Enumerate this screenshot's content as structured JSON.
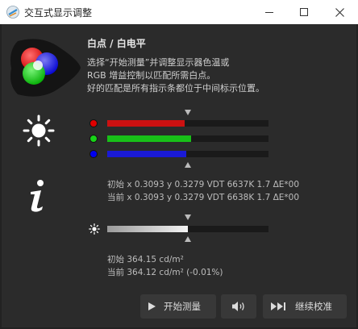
{
  "window": {
    "title": "交互式显示调整"
  },
  "header": {
    "heading": "白点 / 白电平",
    "desc_line1": "选择“开始测量”并调整显示器色温或",
    "desc_line2": "RGB 增益控制以匹配所需白点。",
    "desc_line3": "好的匹配是所有指示条都位于中间标示位置。"
  },
  "rgb_bars": {
    "red": {
      "level": 0.48,
      "color": "#cc1111"
    },
    "green": {
      "level": 0.52,
      "color": "#18c018"
    },
    "blue": {
      "level": 0.49,
      "color": "#1a1ad6"
    }
  },
  "white_point": {
    "initial": "初始 x 0.3093 y 0.3279 VDT 6637K 1.7 ΔE*00",
    "current": "当前 x 0.3093 y 0.3279 VDT 6638K 1.7 ΔE*00"
  },
  "luminance": {
    "level": 0.5,
    "initial": "初始 364.15 cd/m²",
    "current": "当前 364.12 cd/m² (-0.01%)"
  },
  "buttons": {
    "start_label": "开始测量",
    "continue_label": "继续校准"
  },
  "icons": {
    "app": "app-icon",
    "minimize": "minimize-icon",
    "maximize": "maximize-icon",
    "close": "close-icon",
    "rgb": "rgb-circles-icon",
    "brightness": "sun-icon",
    "info": "info-icon",
    "play": "play-icon",
    "speaker": "speaker-icon",
    "skip": "skip-forward-icon"
  }
}
